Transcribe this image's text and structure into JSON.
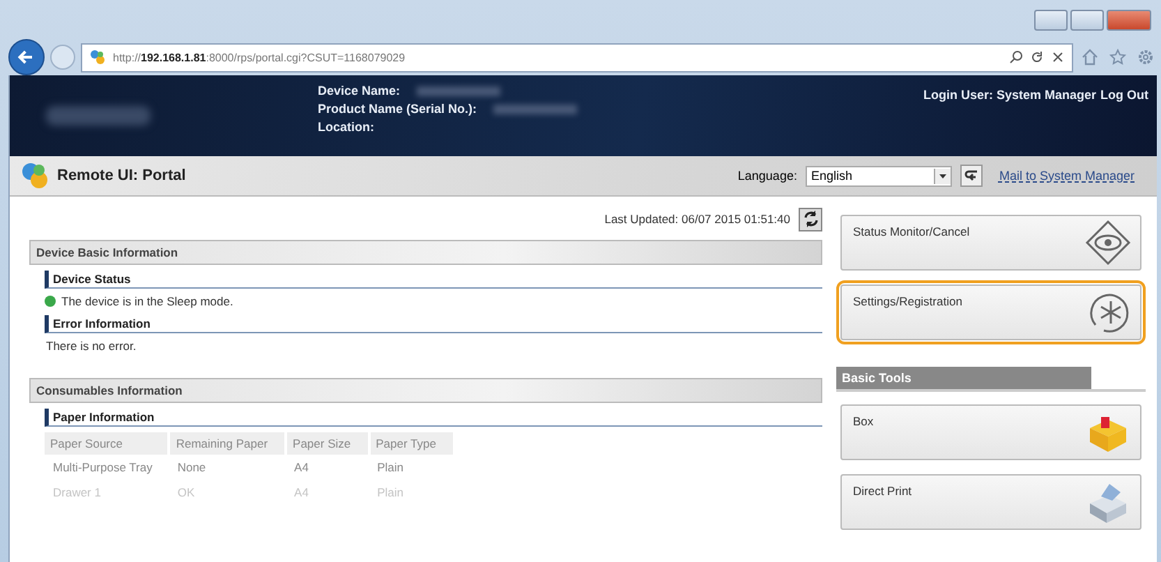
{
  "browser": {
    "url": "http://**192.168.1.81**:8000/rps/portal.cgi?CSUT=1168079029"
  },
  "header": {
    "fields": [
      {
        "label": "Device Name:"
      },
      {
        "label": "Product Name (Serial No.):"
      },
      {
        "label": "Location:"
      }
    ],
    "login_label": "Login User: System Manager",
    "logout": "Log Out"
  },
  "toolbar": {
    "title": "Remote UI: Portal",
    "language_label": "Language:",
    "language": "English",
    "mail_link": "Mail to System Manager"
  },
  "last_updated": "Last Updated: 06/07 2015 01:51:40",
  "sections": [
    {
      "title": "Device Basic Information",
      "blocks": [
        {
          "title": "Device Status",
          "text": "The device is in the Sleep mode.",
          "kind": "status"
        },
        {
          "title": "Error Information",
          "text": "There is no error."
        }
      ]
    },
    {
      "title": "Consumables Information",
      "blocks": [
        {
          "title": "Paper Information",
          "table": {
            "columns": [
              "Paper Source",
              "Remaining Paper",
              "Paper Size",
              "Paper Type"
            ],
            "rows": [
              [
                "Multi-Purpose Tray",
                "None",
                "A4",
                "Plain"
              ],
              [
                "Drawer 1",
                "OK",
                "A4",
                "Plain"
              ]
            ]
          }
        }
      ]
    }
  ],
  "menu": [
    {
      "label": "Status Monitor/Cancel",
      "highlighted": false
    },
    {
      "label": "Settings/Registration",
      "highlighted": true
    }
  ],
  "basic_tools": {
    "title": "Basic Tools",
    "items": [
      {
        "label": "Box",
        "highlighted": false
      },
      {
        "label": "Direct Print",
        "highlighted": false
      }
    ]
  }
}
